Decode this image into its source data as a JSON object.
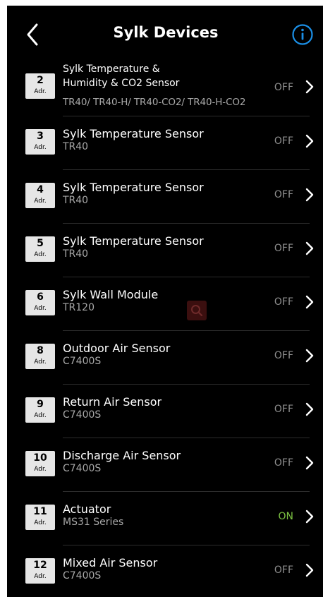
{
  "header": {
    "title": "Sylk Devices",
    "back_icon": "chevron-left-icon",
    "info_icon": "info-circle-icon",
    "accent_color": "#1b8fe6"
  },
  "adr_label": "Adr.",
  "status_colors": {
    "off": "#8e8e8e",
    "on": "#7cc242"
  },
  "devices": [
    {
      "address": "2",
      "name_line1": "Sylk Temperature &",
      "name_line2": "Humidity & CO2 Sensor",
      "model": "TR40/ TR40-H/ TR40-CO2/ TR40-H-CO2",
      "status": "OFF"
    },
    {
      "address": "3",
      "name": "Sylk Temperature Sensor",
      "model": "TR40",
      "status": "OFF"
    },
    {
      "address": "4",
      "name": "Sylk Temperature Sensor",
      "model": "TR40",
      "status": "OFF"
    },
    {
      "address": "5",
      "name": "Sylk Temperature Sensor",
      "model": "TR40",
      "status": "OFF"
    },
    {
      "address": "6",
      "name": "Sylk Wall Module",
      "model": "TR120",
      "status": "OFF"
    },
    {
      "address": "8",
      "name": "Outdoor Air Sensor",
      "model": "C7400S",
      "status": "OFF"
    },
    {
      "address": "9",
      "name": "Return Air Sensor",
      "model": "C7400S",
      "status": "OFF"
    },
    {
      "address": "10",
      "name": "Discharge Air Sensor",
      "model": "C7400S",
      "status": "OFF"
    },
    {
      "address": "11",
      "name": "Actuator",
      "model": "MS31 Series",
      "status": "ON"
    },
    {
      "address": "12",
      "name": "Mixed Air Sensor",
      "model": "C7400S",
      "status": "OFF"
    }
  ]
}
